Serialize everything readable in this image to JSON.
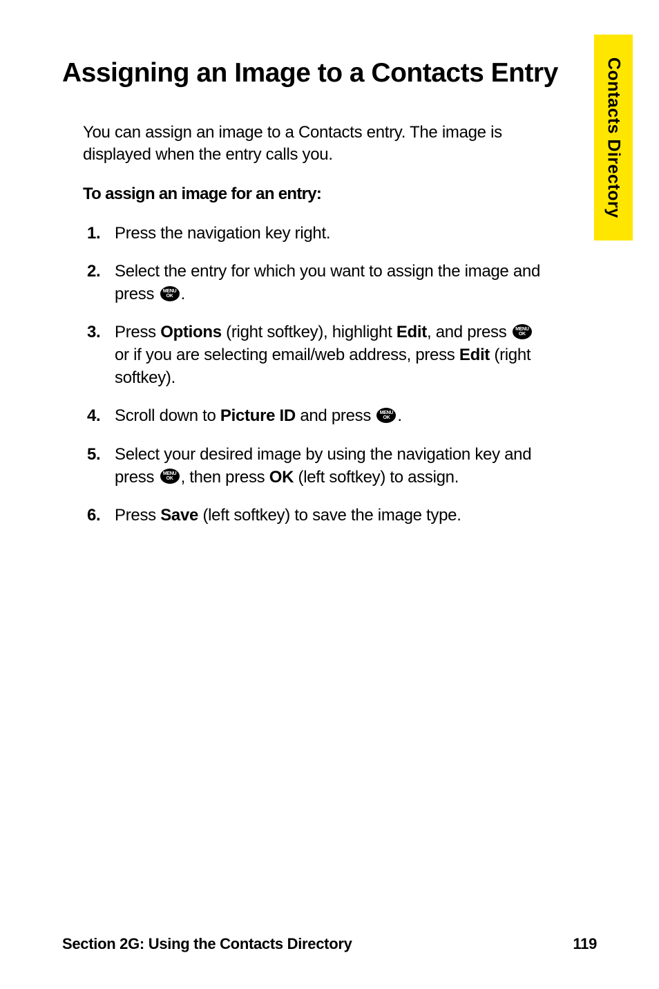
{
  "sideTab": "Contacts Directory",
  "title": "Assigning an Image to a Contacts Entry",
  "intro": "You can assign an image to a Contacts entry. The image is displayed when the entry calls you.",
  "subheading": "To assign an image for an entry:",
  "icon": {
    "line1": "MENU",
    "line2": "OK"
  },
  "steps": [
    {
      "num": "1.",
      "parts": [
        {
          "t": "Press the navigation key right."
        }
      ]
    },
    {
      "num": "2.",
      "parts": [
        {
          "t": "Select the entry for which you want to assign the image and press "
        },
        {
          "icon": true
        },
        {
          "t": "."
        }
      ]
    },
    {
      "num": "3.",
      "parts": [
        {
          "t": "Press "
        },
        {
          "t": "Options",
          "b": true
        },
        {
          "t": " (right softkey), highlight "
        },
        {
          "t": "Edit",
          "b": true
        },
        {
          "t": ", and press "
        },
        {
          "icon": true
        },
        {
          "t": " or if you are selecting email/web address, press "
        },
        {
          "t": "Edit",
          "b": true
        },
        {
          "t": " (right softkey)."
        }
      ]
    },
    {
      "num": "4.",
      "parts": [
        {
          "t": "Scroll down to "
        },
        {
          "t": "Picture ID",
          "b": true
        },
        {
          "t": " and press "
        },
        {
          "icon": true
        },
        {
          "t": "."
        }
      ]
    },
    {
      "num": "5.",
      "parts": [
        {
          "t": "Select your desired image by using the navigation key and"
        },
        {
          "br": true
        },
        {
          "t": "press "
        },
        {
          "icon": true
        },
        {
          "t": ", then press "
        },
        {
          "t": "OK",
          "b": true
        },
        {
          "t": " (left softkey) to assign."
        }
      ]
    },
    {
      "num": "6.",
      "parts": [
        {
          "t": "Press "
        },
        {
          "t": "Save",
          "b": true
        },
        {
          "t": " (left softkey) to save the image type."
        }
      ]
    }
  ],
  "footer": {
    "section": "Section 2G: Using the Contacts Directory",
    "page": "119"
  }
}
